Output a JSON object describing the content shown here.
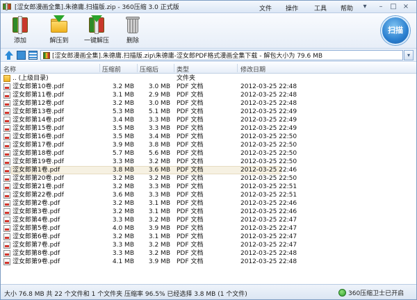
{
  "window": {
    "title": "[涩女郎漫画全集].朱德庸.扫描版.zip - 360压缩 3.0 正式版",
    "menu": [
      "文件",
      "操作",
      "工具",
      "帮助"
    ],
    "controls": {
      "minimize": "–",
      "maximize": "□",
      "close": "×",
      "extra": "▾"
    }
  },
  "toolbar": {
    "buttons": [
      {
        "label": "添加",
        "icon": "zip-add-icon"
      },
      {
        "label": "解压到",
        "icon": "folder-extract-icon"
      },
      {
        "label": "一键解压",
        "icon": "zip-extract-icon"
      },
      {
        "label": "删除",
        "icon": "trash-icon"
      }
    ],
    "scan_label": "扫描"
  },
  "address": {
    "path": "[涩女郎漫画全集].朱德庸.扫描版.zip\\朱德庸-涩女郎PDF格式漫画全集下载 - 解包大小为 79.6 MB",
    "dropdown": "▾"
  },
  "columns": {
    "name": "名称",
    "csize": "压缩前",
    "size": "压缩后",
    "type": "类型",
    "date": "修改日期"
  },
  "files": [
    {
      "name": ".. (上级目录)",
      "csize": "",
      "size": "",
      "type": "文件夹",
      "date": "",
      "icon": "folder-up-icon"
    },
    {
      "name": "涩女郎第10卷.pdf",
      "csize": "3.2 MB",
      "size": "3.0 MB",
      "type": "PDF 文档",
      "date": "2012-03-25 22:48",
      "icon": "pdf-icon"
    },
    {
      "name": "涩女郎第11卷.pdf",
      "csize": "3.1 MB",
      "size": "2.9 MB",
      "type": "PDF 文档",
      "date": "2012-03-25 22:48",
      "icon": "pdf-icon"
    },
    {
      "name": "涩女郎第12卷.pdf",
      "csize": "3.2 MB",
      "size": "3.0 MB",
      "type": "PDF 文档",
      "date": "2012-03-25 22:48",
      "icon": "pdf-icon"
    },
    {
      "name": "涩女郎第13卷.pdf",
      "csize": "5.3 MB",
      "size": "5.1 MB",
      "type": "PDF 文档",
      "date": "2012-03-25 22:49",
      "icon": "pdf-icon"
    },
    {
      "name": "涩女郎第14卷.pdf",
      "csize": "3.4 MB",
      "size": "3.3 MB",
      "type": "PDF 文档",
      "date": "2012-03-25 22:49",
      "icon": "pdf-icon"
    },
    {
      "name": "涩女郎第15卷.pdf",
      "csize": "3.5 MB",
      "size": "3.3 MB",
      "type": "PDF 文档",
      "date": "2012-03-25 22:49",
      "icon": "pdf-icon"
    },
    {
      "name": "涩女郎第16卷.pdf",
      "csize": "3.5 MB",
      "size": "3.4 MB",
      "type": "PDF 文档",
      "date": "2012-03-25 22:50",
      "icon": "pdf-icon"
    },
    {
      "name": "涩女郎第17卷.pdf",
      "csize": "3.9 MB",
      "size": "3.8 MB",
      "type": "PDF 文档",
      "date": "2012-03-25 22:50",
      "icon": "pdf-icon"
    },
    {
      "name": "涩女郎第18卷.pdf",
      "csize": "5.7 MB",
      "size": "5.6 MB",
      "type": "PDF 文档",
      "date": "2012-03-25 22:50",
      "icon": "pdf-icon"
    },
    {
      "name": "涩女郎第19卷.pdf",
      "csize": "3.3 MB",
      "size": "3.2 MB",
      "type": "PDF 文档",
      "date": "2012-03-25 22:50",
      "icon": "pdf-icon"
    },
    {
      "name": "涩女郎第1卷.pdf",
      "csize": "3.8 MB",
      "size": "3.6 MB",
      "type": "PDF 文档",
      "date": "2012-03-25 22:46",
      "icon": "pdf-icon",
      "selected": true
    },
    {
      "name": "涩女郎第20卷.pdf",
      "csize": "3.2 MB",
      "size": "3.2 MB",
      "type": "PDF 文档",
      "date": "2012-03-25 22:50",
      "icon": "pdf-icon"
    },
    {
      "name": "涩女郎第21卷.pdf",
      "csize": "3.2 MB",
      "size": "3.3 MB",
      "type": "PDF 文档",
      "date": "2012-03-25 22:51",
      "icon": "pdf-icon"
    },
    {
      "name": "涩女郎第22卷.pdf",
      "csize": "3.6 MB",
      "size": "3.3 MB",
      "type": "PDF 文档",
      "date": "2012-03-25 22:51",
      "icon": "pdf-icon"
    },
    {
      "name": "涩女郎第2卷.pdf",
      "csize": "3.2 MB",
      "size": "3.1 MB",
      "type": "PDF 文档",
      "date": "2012-03-25 22:46",
      "icon": "pdf-icon"
    },
    {
      "name": "涩女郎第3卷.pdf",
      "csize": "3.2 MB",
      "size": "3.1 MB",
      "type": "PDF 文档",
      "date": "2012-03-25 22:46",
      "icon": "pdf-icon"
    },
    {
      "name": "涩女郎第4卷.pdf",
      "csize": "3.3 MB",
      "size": "3.2 MB",
      "type": "PDF 文档",
      "date": "2012-03-25 22:47",
      "icon": "pdf-icon"
    },
    {
      "name": "涩女郎第5卷.pdf",
      "csize": "4.0 MB",
      "size": "3.9 MB",
      "type": "PDF 文档",
      "date": "2012-03-25 22:47",
      "icon": "pdf-icon"
    },
    {
      "name": "涩女郎第6卷.pdf",
      "csize": "3.2 MB",
      "size": "3.1 MB",
      "type": "PDF 文档",
      "date": "2012-03-25 22:47",
      "icon": "pdf-icon"
    },
    {
      "name": "涩女郎第7卷.pdf",
      "csize": "3.3 MB",
      "size": "3.2 MB",
      "type": "PDF 文档",
      "date": "2012-03-25 22:47",
      "icon": "pdf-icon"
    },
    {
      "name": "涩女郎第8卷.pdf",
      "csize": "3.3 MB",
      "size": "3.2 MB",
      "type": "PDF 文档",
      "date": "2012-03-25 22:48",
      "icon": "pdf-icon"
    },
    {
      "name": "涩女郎第9卷.pdf",
      "csize": "4.1 MB",
      "size": "3.9 MB",
      "type": "PDF 文档",
      "date": "2012-03-25 22:48",
      "icon": "pdf-icon"
    }
  ],
  "status": {
    "text": "大小 76.8 MB 共 22 个文件和 1 个文件夹 压缩率 96.5% 已经选择 3.8 MB (1 个文件)",
    "guard": "360压缩卫士已开启"
  }
}
